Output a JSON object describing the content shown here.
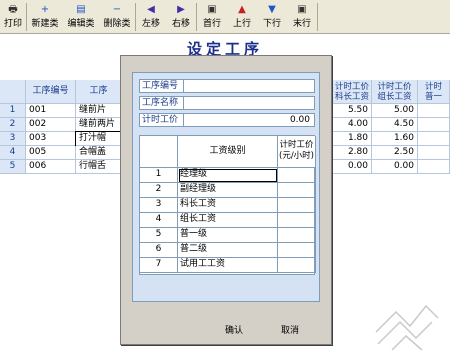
{
  "toolbar": {
    "buttons": [
      {
        "label": "打印",
        "icon": "printer-icon",
        "glyph": "🖶",
        "color": "#333333"
      },
      {
        "label": "新建类",
        "icon": "new-icon",
        "glyph": "+",
        "color": "#1e56c8"
      },
      {
        "label": "编辑类",
        "icon": "edit-icon",
        "glyph": "▤",
        "color": "#1e56c8"
      },
      {
        "label": "删除类",
        "icon": "delete-icon",
        "glyph": "−",
        "color": "#1e56c8"
      },
      {
        "label": "左移",
        "icon": "arrow-left-icon",
        "glyph": "◀",
        "color": "#4b2aa8"
      },
      {
        "label": "右移",
        "icon": "arrow-right-icon",
        "glyph": "▶",
        "color": "#4b2aa8"
      },
      {
        "label": "首行",
        "icon": "first-row-icon",
        "glyph": "▣",
        "color": "#333333"
      },
      {
        "label": "上行",
        "icon": "up-icon",
        "glyph": "▲",
        "color": "#c81e1e"
      },
      {
        "label": "下行",
        "icon": "down-icon",
        "glyph": "▼",
        "color": "#1e56c8"
      },
      {
        "label": "末行",
        "icon": "last-row-icon",
        "glyph": "▣",
        "color": "#333333"
      }
    ]
  },
  "page_title": "设定工序",
  "grid": {
    "col_code": "工序编号",
    "col_name": "工序",
    "col_rate1": [
      "计时工价",
      "科长工资"
    ],
    "col_rate2": [
      "计时工价",
      "组长工资"
    ],
    "col_rate3": [
      "计时",
      "普一"
    ],
    "rows": [
      {
        "no": "1",
        "code": "001",
        "name": "缝前片",
        "r1": "5.50",
        "r2": "5.00"
      },
      {
        "no": "2",
        "code": "002",
        "name": "缝前两片",
        "r1": "4.00",
        "r2": "4.50"
      },
      {
        "no": "3",
        "code": "003",
        "name": "打汁帽",
        "r1": "1.80",
        "r2": "1.60"
      },
      {
        "no": "4",
        "code": "005",
        "name": "合帽盖",
        "r1": "2.80",
        "r2": "2.50"
      },
      {
        "no": "5",
        "code": "006",
        "name": "行帽舌",
        "r1": "0.00",
        "r2": "0.00"
      }
    ]
  },
  "dialog": {
    "field_code_label": "工序编号",
    "field_code_value": "",
    "field_name_label": "工序名称",
    "field_name_value": "",
    "field_rate_label": "计时工价",
    "field_rate_value": "0.00",
    "level_col_header": "工资级别",
    "rate_col_header": [
      "计时工价",
      "(元/小时)"
    ],
    "levels": [
      {
        "no": "1",
        "name": "经理级",
        "rate": ""
      },
      {
        "no": "2",
        "name": "副经理级",
        "rate": ""
      },
      {
        "no": "3",
        "name": "科长工资",
        "rate": ""
      },
      {
        "no": "4",
        "name": "组长工资",
        "rate": ""
      },
      {
        "no": "5",
        "name": "普一级",
        "rate": ""
      },
      {
        "no": "6",
        "name": "普二级",
        "rate": ""
      },
      {
        "no": "7",
        "name": "试用工工资",
        "rate": ""
      }
    ],
    "ok_label": "确认",
    "cancel_label": "取消"
  }
}
